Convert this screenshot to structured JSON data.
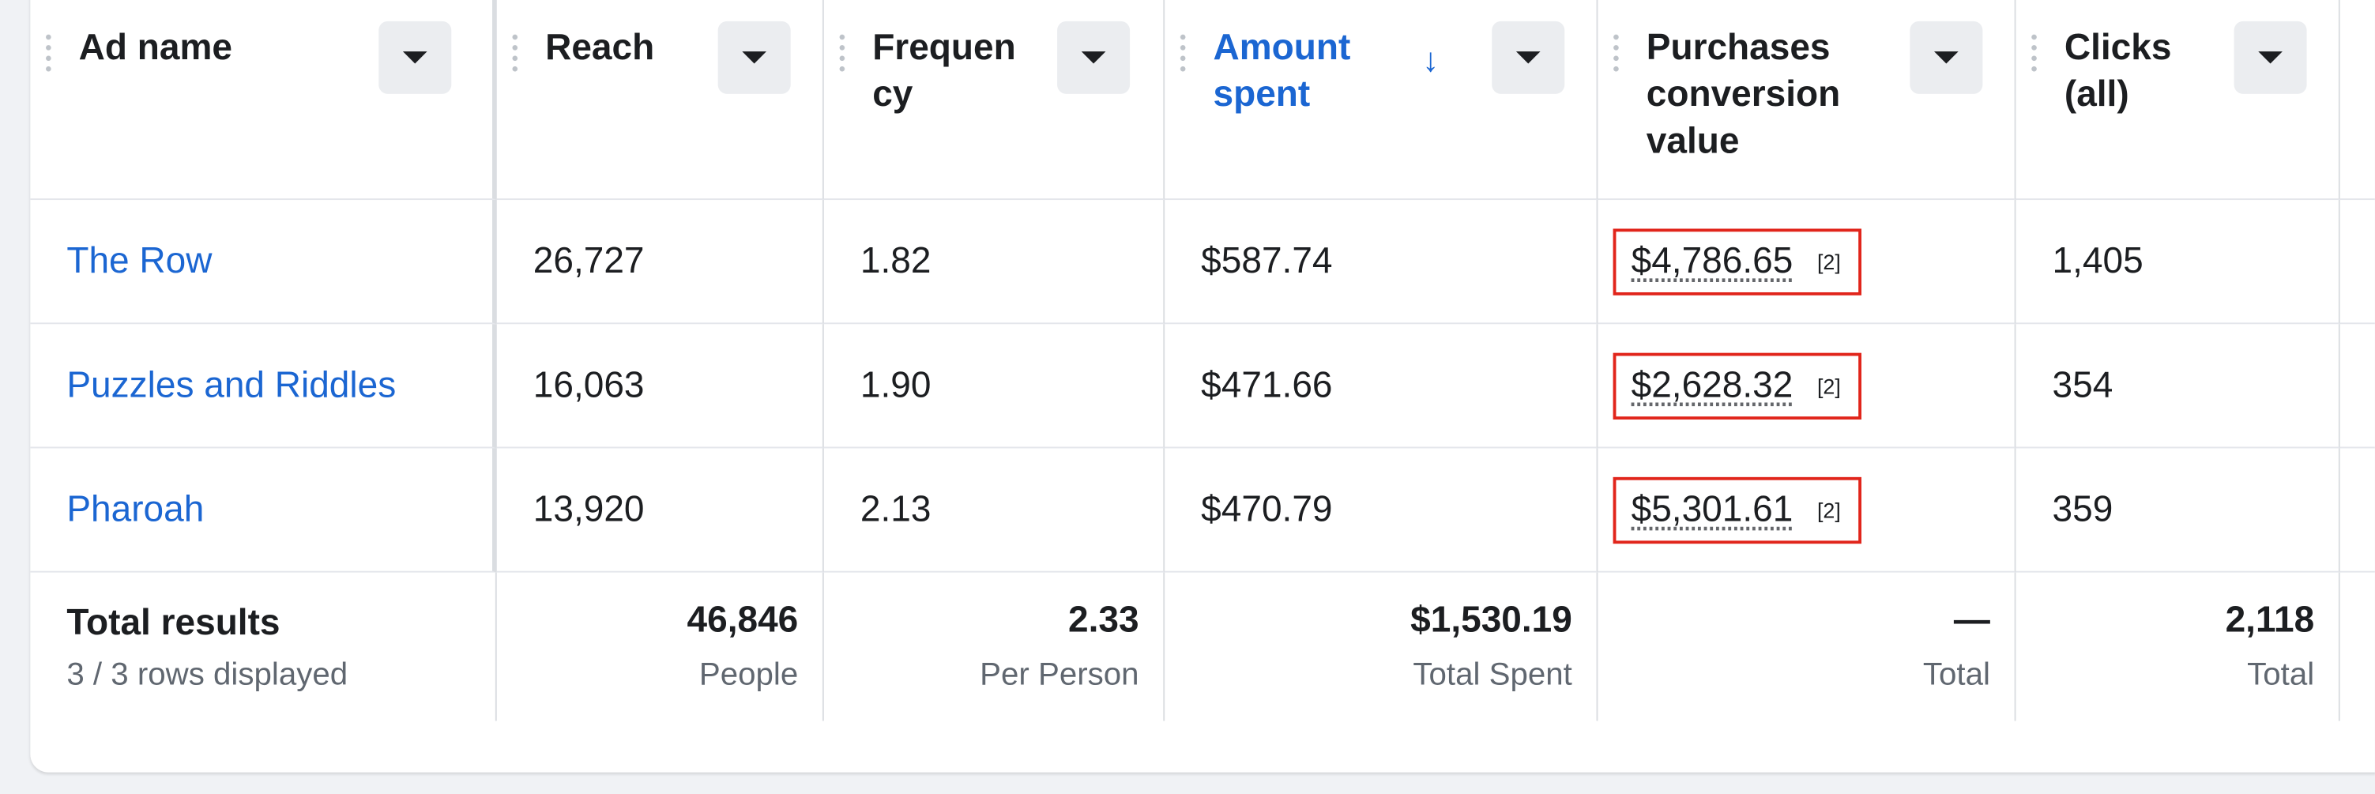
{
  "headers": {
    "ad_name": "Ad name",
    "reach": "Reach",
    "frequency": "Frequen cy",
    "amount_spent": "Amount spent",
    "purchases": "Purchases conversion value",
    "clicks": "Clicks (all)"
  },
  "sort_arrow": "↓",
  "rows": [
    {
      "name": "The Row",
      "reach": "26,727",
      "frequency": "1.82",
      "amount": "$587.74",
      "purchases": "$4,786.65",
      "attr": "[2]",
      "clicks": "1,405"
    },
    {
      "name": "Puzzles and Riddles",
      "reach": "16,063",
      "frequency": "1.90",
      "amount": "$471.66",
      "purchases": "$2,628.32",
      "attr": "[2]",
      "clicks": "354"
    },
    {
      "name": "Pharoah",
      "reach": "13,920",
      "frequency": "2.13",
      "amount": "$470.79",
      "purchases": "$5,301.61",
      "attr": "[2]",
      "clicks": "359"
    }
  ],
  "totals": {
    "label": "Total results",
    "rows_displayed": "3 / 3 rows displayed",
    "reach": "46,846",
    "reach_sub": "People",
    "frequency": "2.33",
    "frequency_sub": "Per Person",
    "amount": "$1,530.19",
    "amount_sub": "Total Spent",
    "purchases": "—",
    "purchases_sub": "Total",
    "clicks": "2,118",
    "clicks_sub": "Total"
  },
  "colors": {
    "link": "#1b66d2",
    "highlight_box": "#e1251b",
    "muted_text": "#606770"
  }
}
